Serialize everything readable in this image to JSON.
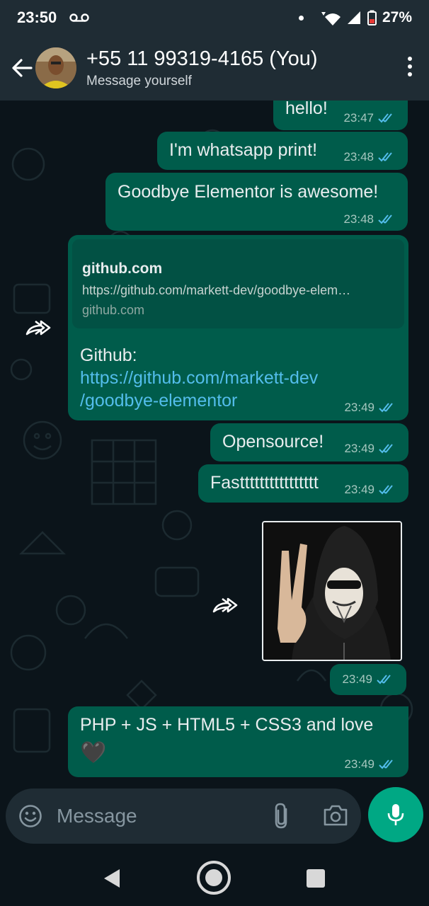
{
  "status_bar": {
    "time": "23:50",
    "battery": "27%",
    "icons": [
      "voicemail-icon",
      "notification-dot-icon",
      "wifi-icon",
      "signal-icon",
      "battery-icon"
    ]
  },
  "header": {
    "contact_name": "+55 11 99319-4165 (You)",
    "subtitle": "Message yourself",
    "icons": [
      "back-arrow-icon",
      "avatar",
      "more-options-icon"
    ]
  },
  "messages": [
    {
      "id": "m1",
      "text": "hello!",
      "time": "23:47"
    },
    {
      "id": "m2",
      "text": "I'm whatsapp print!",
      "time": "23:48"
    },
    {
      "id": "m3",
      "text": "Goodbye Elementor is awesome!",
      "time": "23:48"
    },
    {
      "id": "m4",
      "link_preview": {
        "title": "github.com",
        "url": "https://github.com/markett-dev/goodbye-elem…",
        "domain": "github.com"
      },
      "text_line1": "Github:",
      "link_line1": "https://github.com/markett-dev",
      "link_line2": "/goodbye-elementor",
      "time": "23:49"
    },
    {
      "id": "m5",
      "text": "Opensource!",
      "time": "23:49"
    },
    {
      "id": "m6",
      "text": "Fastttttttttttttttt",
      "time": "23:49"
    },
    {
      "id": "m7",
      "image": "hooded-figure-mask-peace-sign",
      "time": "23:49"
    },
    {
      "id": "m8",
      "text": "PHP + JS + HTML5 + CSS3 and love",
      "emoji": "🖤",
      "time": "23:49"
    }
  ],
  "input_bar": {
    "placeholder": "Message",
    "icons": [
      "emoji-icon",
      "attach-icon",
      "camera-icon",
      "microphone-icon"
    ]
  },
  "colors": {
    "background": "#0b141a",
    "header": "#1f2c34",
    "outgoing_bubble": "#005c4b",
    "link_blue": "#53bdeb",
    "read_ticks": "#53bdeb",
    "mic_button": "#00a884"
  }
}
